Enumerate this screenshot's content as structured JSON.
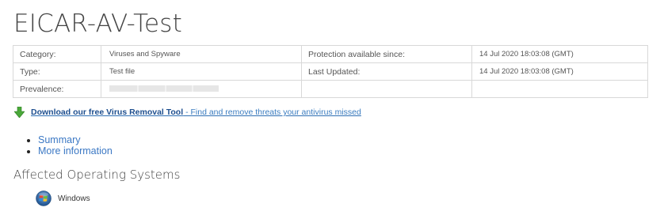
{
  "page": {
    "title": "EICAR-AV-Test"
  },
  "info_table": {
    "rows": [
      {
        "label": "Category:",
        "value": "Viruses and Spyware",
        "label2": "Protection available since:",
        "value2": "14 Jul 2020 18:03:08 (GMT)"
      },
      {
        "label": "Type:",
        "value": "Test file",
        "label2": "Last Updated:",
        "value2": "14 Jul 2020 18:03:08 (GMT)"
      },
      {
        "label": "Prevalence:",
        "value": "",
        "label2": "",
        "value2": ""
      }
    ]
  },
  "download": {
    "icon": "green-down-arrow-icon",
    "link_strong": "Download our free Virus Removal Tool",
    "link_rest": " - Find and remove threats your antivirus missed"
  },
  "links": [
    {
      "label": "Summary"
    },
    {
      "label": "More information"
    }
  ],
  "affected": {
    "heading": "Affected Operating Systems",
    "os": [
      {
        "name": "Windows",
        "icon": "windows-logo-icon"
      }
    ]
  },
  "colors": {
    "link": "#3b78c4",
    "download_link": "#1e4f8f",
    "border": "#d8d8d8",
    "arrow": "#4aa83a"
  }
}
